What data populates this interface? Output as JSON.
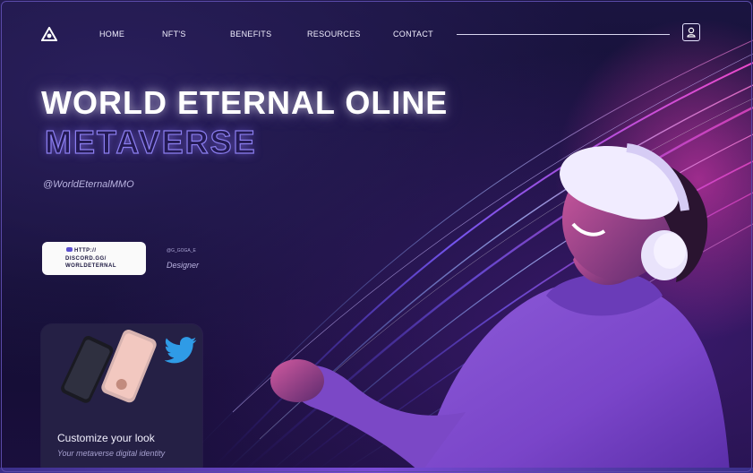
{
  "nav": {
    "items": [
      "HOME",
      "NFT'S",
      "BENEFITS",
      "RESOURCES",
      "CONTACT"
    ]
  },
  "hero": {
    "title_line1": "WORLD ETERNAL OLINE",
    "title_line2": "METAVERSE",
    "handle": "@WorldEternalMMO"
  },
  "discord": {
    "line1": "HTTP://",
    "line2": "DISCORD.GG/",
    "line3": "WORLDETERNAL"
  },
  "credit": {
    "handle": "@G_GOGA_E",
    "role": "Designer"
  },
  "card": {
    "title": "Customize your look",
    "subtitle": "Your metaverse digital identity"
  },
  "colors": {
    "background": "#14102e",
    "accent_purple": "#8c7ff0",
    "twitter_blue": "#2f9be6"
  },
  "icons": [
    "logo-icon",
    "user-icon",
    "discord-icon",
    "twitter-icon"
  ]
}
